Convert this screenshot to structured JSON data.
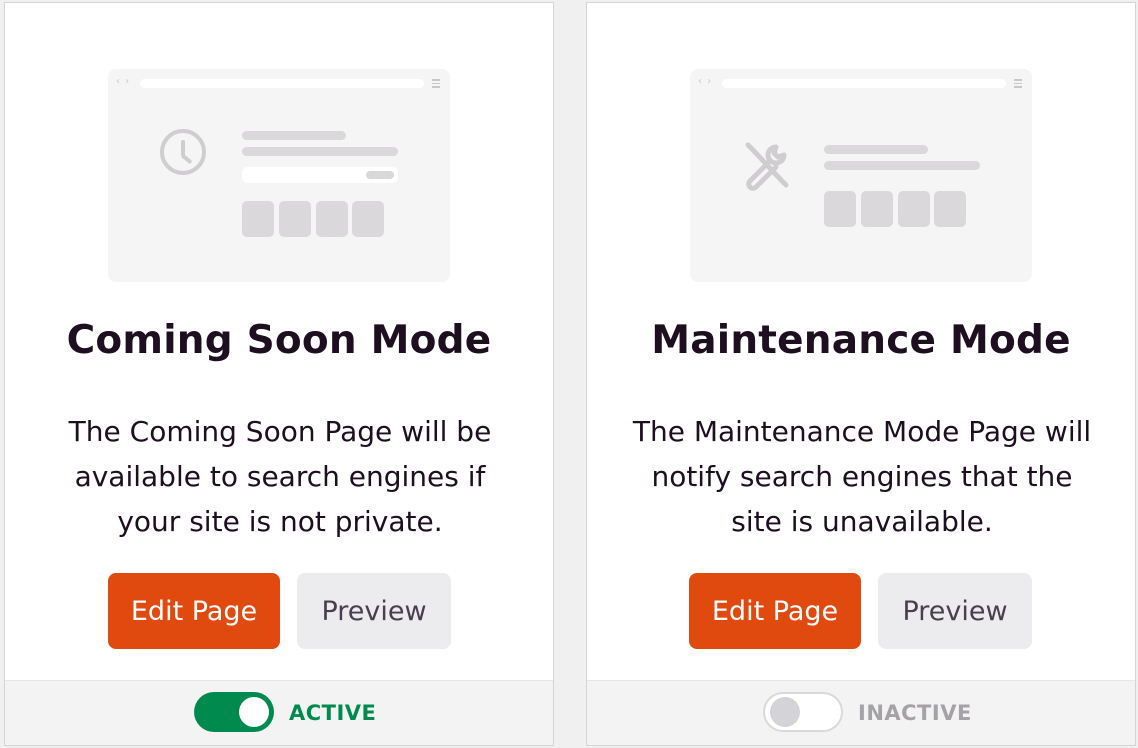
{
  "cards": [
    {
      "title": "Coming Soon Mode",
      "description": "The Coming Soon Page will be available to search engines if your site is not private.",
      "edit_label": "Edit Page",
      "preview_label": "Preview",
      "status": "ACTIVE",
      "toggle_on": true,
      "illustration_icon": "clock-icon"
    },
    {
      "title": "Maintenance Mode",
      "description": "The Maintenance Mode Page will notify search engines that the site is unavailable.",
      "edit_label": "Edit Page",
      "preview_label": "Preview",
      "status": "INACTIVE",
      "toggle_on": false,
      "illustration_icon": "tools-icon"
    }
  ],
  "illustration": {
    "nav_glyphs": "‹ ›"
  },
  "colors": {
    "accent": "#e04a0f",
    "active": "#008a4e",
    "inactive": "#a4a2a6",
    "text": "#1d0f1f"
  }
}
